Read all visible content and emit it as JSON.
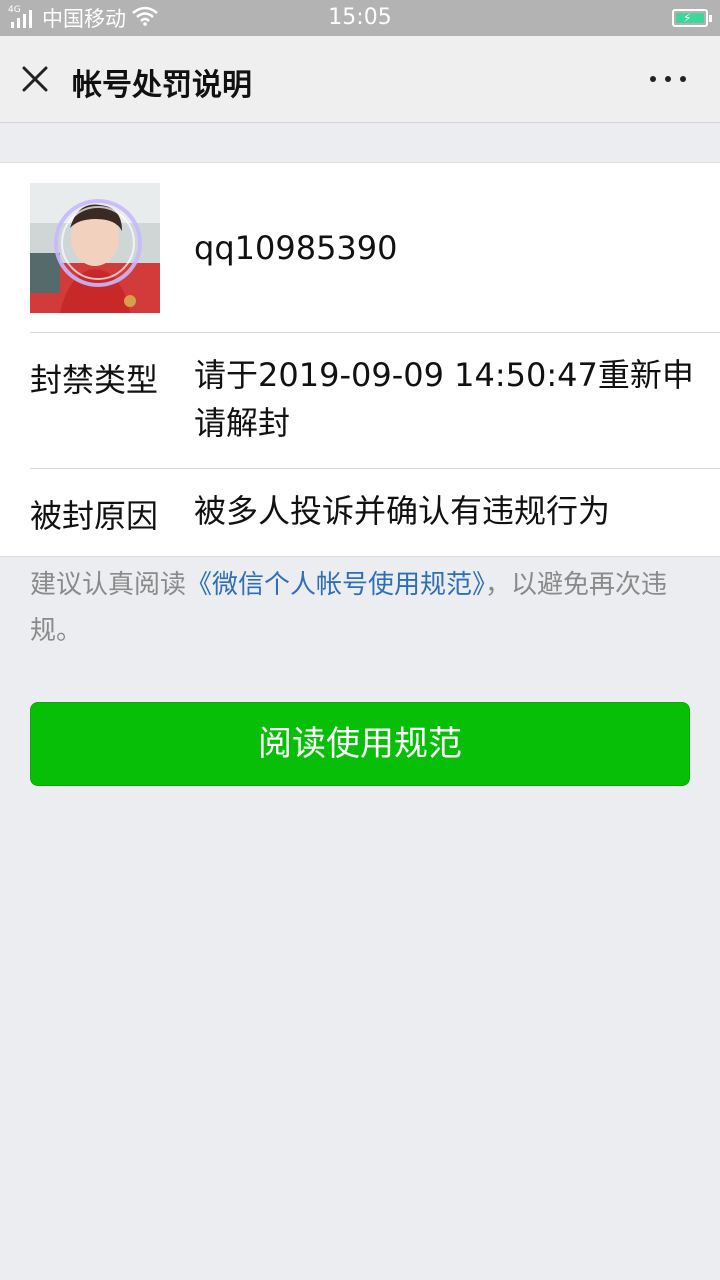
{
  "status_bar": {
    "network": "4G",
    "carrier": "中国移动",
    "time": "15:05"
  },
  "nav": {
    "title": "帐号处罚说明"
  },
  "account": {
    "username": "qq10985390",
    "ban_type_label": "封禁类型",
    "ban_type_value": "请于2019-09-09 14:50:47重新申请解封",
    "reason_label": "被封原因",
    "reason_value": "被多人投诉并确认有违规行为"
  },
  "notice": {
    "prefix": "建议认真阅读",
    "link": "《微信个人帐号使用规范》",
    "suffix": "，以避免再次违规。"
  },
  "button": {
    "label": "阅读使用规范"
  },
  "colors": {
    "primary": "#08bf08",
    "link": "#2f6fb7",
    "battery": "#3dd69b"
  }
}
